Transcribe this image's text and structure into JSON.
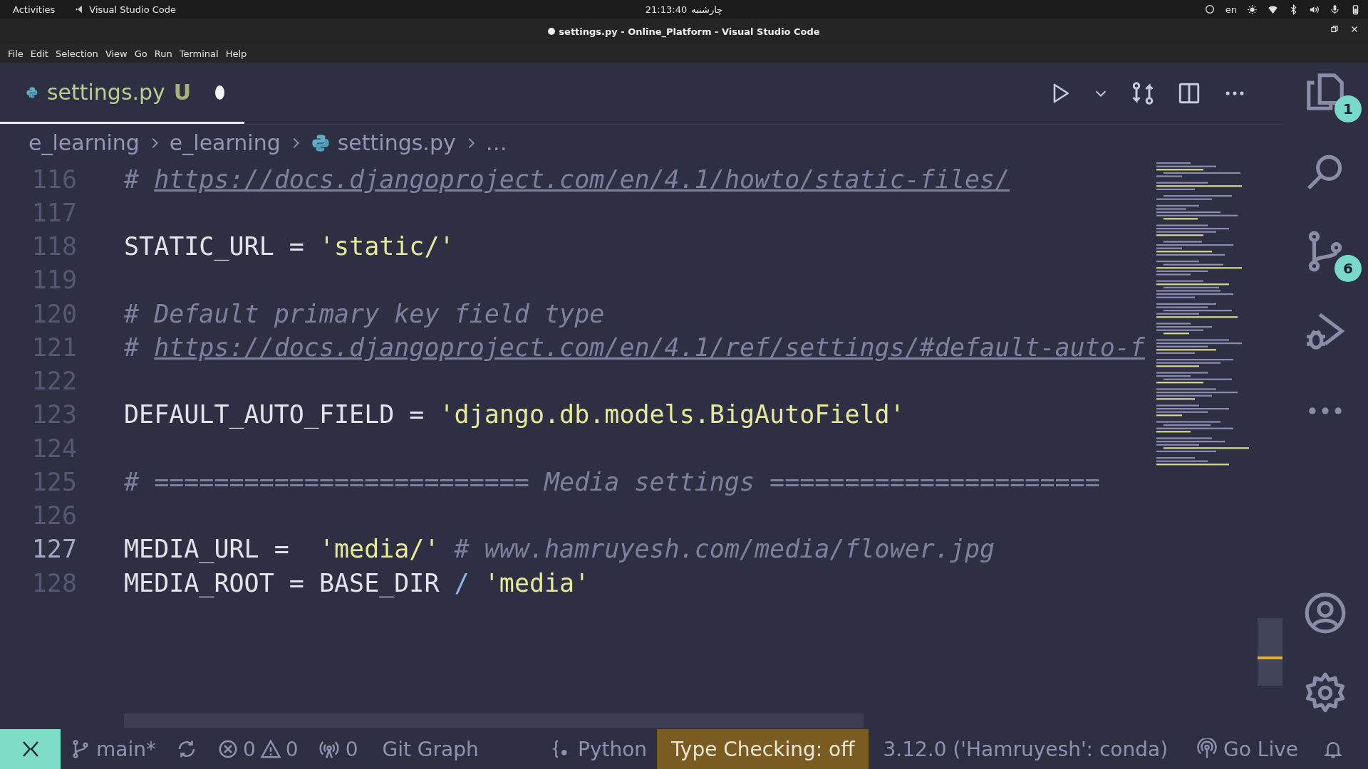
{
  "system_bar": {
    "activities": "Activities",
    "app": "Visual Studio Code",
    "time": "21:13:40",
    "day": "چارشنبه",
    "language": "en"
  },
  "window": {
    "title": "settings.py - Online_Platform - Visual Studio Code",
    "modified": true
  },
  "menu": [
    "File",
    "Edit",
    "Selection",
    "View",
    "Go",
    "Run",
    "Terminal",
    "Help"
  ],
  "tabs": [
    {
      "label": "settings.py",
      "git_status": "U",
      "dirty": true,
      "selected": true
    }
  ],
  "breadcrumbs": [
    {
      "kind": "folder",
      "label": "e_learning"
    },
    {
      "kind": "folder",
      "label": "e_learning"
    },
    {
      "kind": "file",
      "label": "settings.py"
    },
    {
      "kind": "more",
      "label": "…"
    }
  ],
  "editor": {
    "lines": [
      {
        "number": "116",
        "current": false,
        "tokens": [
          {
            "kind": "comment",
            "text": "# "
          },
          {
            "kind": "link",
            "text": "https://docs.djangoproject.com/en/4.1/howto/static-files/"
          }
        ]
      },
      {
        "number": "117",
        "current": false
      },
      {
        "number": "118",
        "current": false,
        "tokens": [
          {
            "kind": "plain",
            "text": "STATIC_URL = "
          },
          {
            "kind": "string",
            "text": "'static/'"
          }
        ]
      },
      {
        "number": "119",
        "current": false
      },
      {
        "number": "120",
        "current": false,
        "tokens": [
          {
            "kind": "comment",
            "text": "# Default primary key field type"
          }
        ]
      },
      {
        "number": "121",
        "current": false,
        "tokens": [
          {
            "kind": "comment",
            "text": "# "
          },
          {
            "kind": "link",
            "text": "https://docs.djangoproject.com/en/4.1/ref/settings/#default-auto-f"
          }
        ]
      },
      {
        "number": "122",
        "current": false
      },
      {
        "number": "123",
        "current": false,
        "tokens": [
          {
            "kind": "plain",
            "text": "DEFAULT_AUTO_FIELD = "
          },
          {
            "kind": "string",
            "text": "'django.db.models.BigAutoField'"
          }
        ]
      },
      {
        "number": "124",
        "current": false
      },
      {
        "number": "125",
        "current": false,
        "tokens": [
          {
            "kind": "comment",
            "text": "# ========================= Media settings ======================"
          }
        ]
      },
      {
        "number": "126",
        "current": false
      },
      {
        "number": "127",
        "current": true,
        "tokens": [
          {
            "kind": "plain",
            "text": "MEDIA_URL =  "
          },
          {
            "kind": "string",
            "text": "'media/'"
          },
          {
            "kind": "comment",
            "text": " # www.hamruyesh.com/media/flower.jpg"
          }
        ]
      },
      {
        "number": "128",
        "current": false,
        "tokens": [
          {
            "kind": "plain",
            "text": "MEDIA_ROOT = BASE_DIR "
          },
          {
            "kind": "operator",
            "text": "/"
          },
          {
            "kind": "string",
            "text": " 'media'"
          }
        ]
      }
    ]
  },
  "activity_bar": [
    {
      "kind": "explorer",
      "badge": "1"
    },
    {
      "kind": "search"
    },
    {
      "kind": "source-control",
      "badge": "6"
    },
    {
      "kind": "run-debug"
    },
    {
      "kind": "more"
    },
    {
      "kind": "account"
    },
    {
      "kind": "settings"
    }
  ],
  "status_bar": [
    {
      "kind": "remote"
    },
    {
      "kind": "branch",
      "text": "main*"
    },
    {
      "kind": "sync"
    },
    {
      "kind": "problems",
      "errors": "0",
      "warnings": "0"
    },
    {
      "kind": "ports",
      "text": "0"
    },
    {
      "kind": "text",
      "text": "Git Graph"
    },
    {
      "kind": "language",
      "text": "Python"
    },
    {
      "kind": "highlight",
      "text": "Type Checking: off"
    },
    {
      "kind": "text",
      "text": "3.12.0 ('Hamruyesh': conda)"
    },
    {
      "kind": "golive",
      "text": "Go Live"
    },
    {
      "kind": "bell"
    }
  ]
}
